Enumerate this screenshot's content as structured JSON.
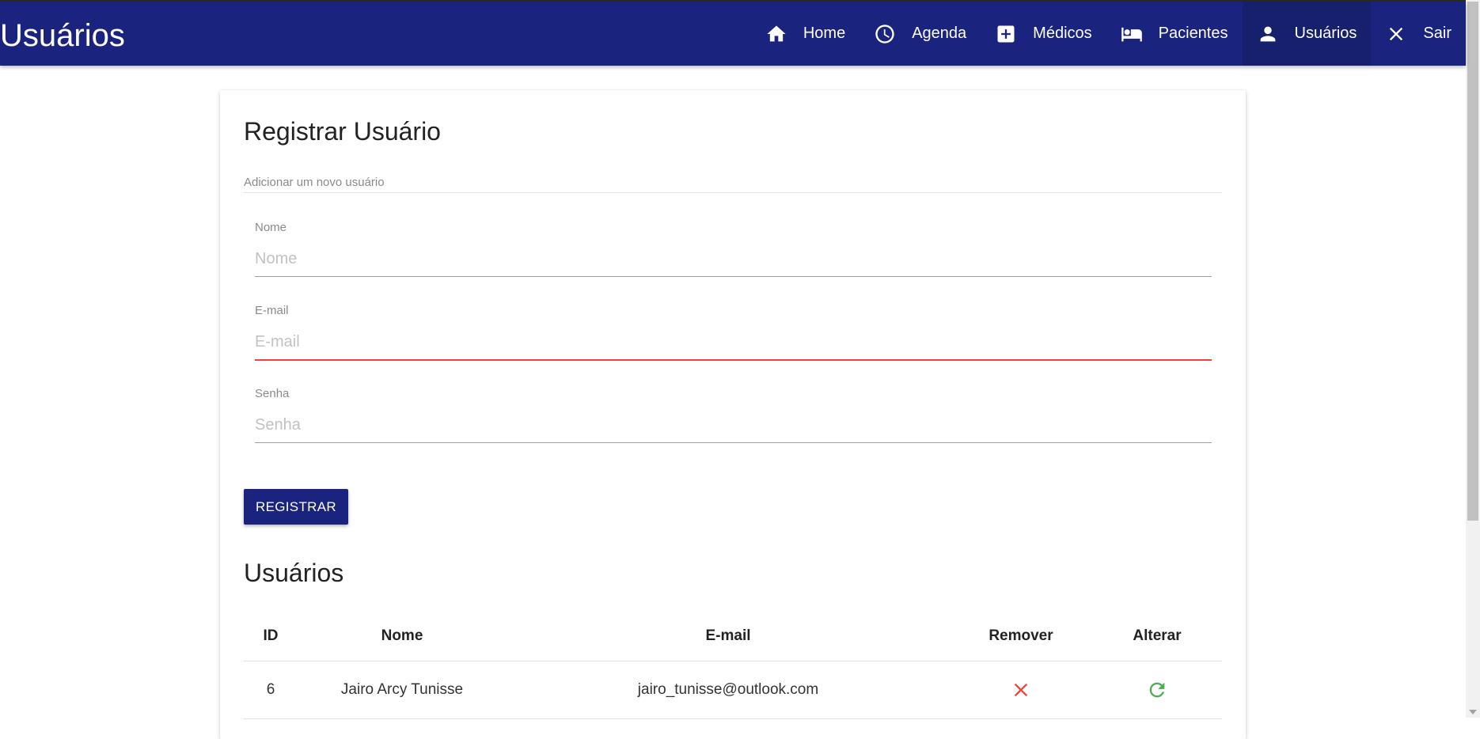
{
  "header": {
    "title": "Usuários",
    "nav": [
      {
        "label": "Home",
        "icon": "home-icon"
      },
      {
        "label": "Agenda",
        "icon": "clock-icon"
      },
      {
        "label": "Médicos",
        "icon": "medical-plus-icon"
      },
      {
        "label": "Pacientes",
        "icon": "hotel-bed-icon"
      },
      {
        "label": "Usuários",
        "icon": "person-icon",
        "active": true
      },
      {
        "label": "Sair",
        "icon": "close-icon"
      }
    ]
  },
  "form": {
    "title": "Registrar Usuário",
    "subtitle": "Adicionar um novo usuário",
    "fields": {
      "name": {
        "label": "Nome",
        "placeholder": "Nome",
        "value": ""
      },
      "email": {
        "label": "E-mail",
        "placeholder": "E-mail",
        "value": "",
        "invalid": true
      },
      "password": {
        "label": "Senha",
        "placeholder": "Senha",
        "value": ""
      }
    },
    "submit_label": "REGISTRAR"
  },
  "users": {
    "title": "Usuários",
    "columns": [
      "ID",
      "Nome",
      "E-mail",
      "Remover",
      "Alterar"
    ],
    "rows": [
      {
        "id": "6",
        "name": "Jairo Arcy Tunisse",
        "email": "jairo_tunisse@outlook.com",
        "remove_icon": "close-icon",
        "edit_icon": "refresh-icon"
      }
    ]
  },
  "colors": {
    "primary": "#1a237e",
    "nav_active": "#17206c",
    "error": "#f44336",
    "remove": "#f44336",
    "edit": "#4caf50"
  }
}
